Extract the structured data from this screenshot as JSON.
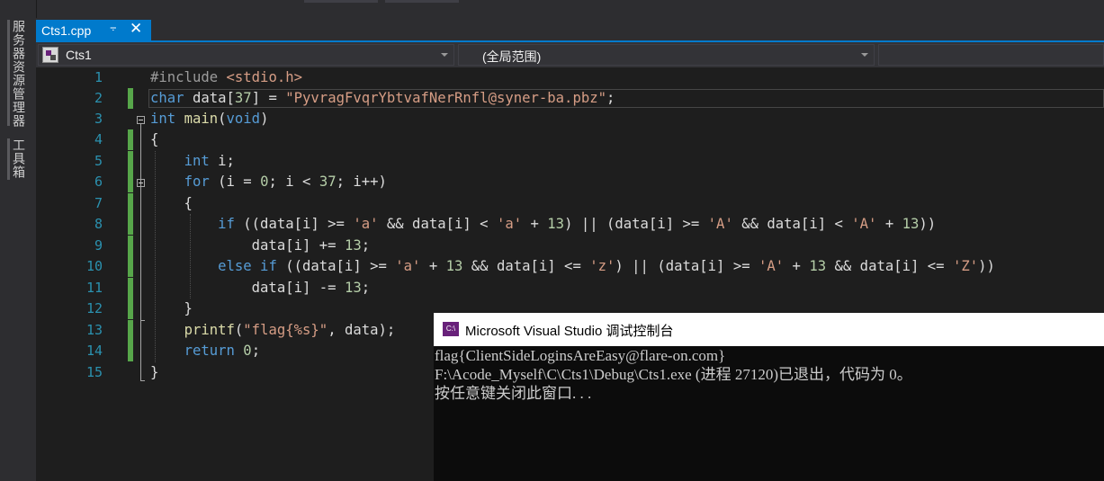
{
  "side_tabs": [
    "服务器资源管理器",
    "工具箱"
  ],
  "editor_tab": {
    "title": "Cts1.cpp",
    "pin_icon": "pin-icon",
    "close_icon": "close-icon"
  },
  "navigation": {
    "project": "Cts1",
    "scope": "(全局范围)"
  },
  "code_lines": [
    {
      "num": "1",
      "text": "#include <stdio.h>"
    },
    {
      "num": "2",
      "text": "char data[37] = \"PyvragFvqrYbtvafNerRnfl@syner-ba.pbz\";"
    },
    {
      "num": "3",
      "text": "int main(void)"
    },
    {
      "num": "4",
      "text": "{"
    },
    {
      "num": "5",
      "text": "    int i;"
    },
    {
      "num": "6",
      "text": "    for (i = 0; i < 37; i++)"
    },
    {
      "num": "7",
      "text": "    {"
    },
    {
      "num": "8",
      "text": "        if ((data[i] >= 'a' && data[i] < 'a' + 13) || (data[i] >= 'A' && data[i] < 'A' + 13))"
    },
    {
      "num": "9",
      "text": "            data[i] += 13;"
    },
    {
      "num": "10",
      "text": "        else if ((data[i] >= 'a' + 13 && data[i] <= 'z') || (data[i] >= 'A' + 13 && data[i] <= 'Z'))"
    },
    {
      "num": "11",
      "text": "            data[i] -= 13;"
    },
    {
      "num": "12",
      "text": "    }"
    },
    {
      "num": "13",
      "text": "    printf(\"flag{%s}\", data);"
    },
    {
      "num": "14",
      "text": "    return 0;"
    },
    {
      "num": "15",
      "text": "}"
    }
  ],
  "console": {
    "title": "Microsoft Visual Studio 调试控制台",
    "icon_label": "C:\\",
    "lines": [
      "flag{ClientSideLoginsAreEasy@flare-on.com}",
      "F:\\Acode_Myself\\C\\Cts1\\Debug\\Cts1.exe (进程 27120)已退出，代码为 0。",
      "按任意键关闭此窗口. . ."
    ]
  },
  "colors": {
    "accent": "#007acc",
    "keyword": "#569cd6",
    "string": "#d69d85",
    "number": "#b5cea8",
    "function": "#dcdcaa",
    "line_number": "#2b91af",
    "change_bar": "#57a64a"
  }
}
